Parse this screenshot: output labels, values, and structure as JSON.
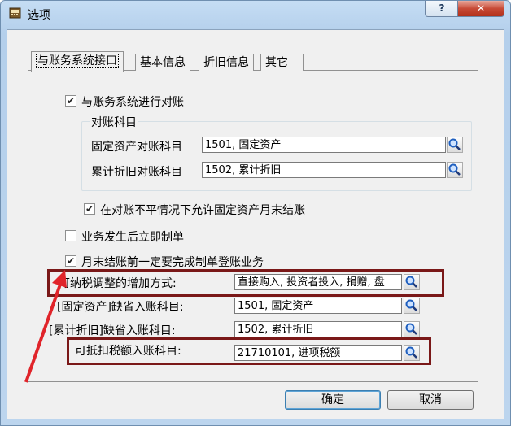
{
  "window": {
    "title": "选项",
    "help_label": "?",
    "close_label": "✕"
  },
  "tabs": [
    {
      "label": "与账务系统接口",
      "active": true
    },
    {
      "label": "基本信息",
      "active": false
    },
    {
      "label": "折旧信息",
      "active": false
    },
    {
      "label": "其它",
      "active": false
    }
  ],
  "options": {
    "reconcile": {
      "label": "与账务系统进行对账",
      "checked": true
    },
    "allow_close": {
      "label": "在对账不平情况下允许固定资产月末结账",
      "checked": true
    },
    "voucher_immediately": {
      "label": "业务发生后立即制单",
      "checked": false
    },
    "month_end": {
      "label": "月末结账前一定要完成制单登账业务",
      "checked": true
    }
  },
  "reconcile_accounts": {
    "group_title": "对账科目",
    "fixed_asset": {
      "label": "固定资产对账科目",
      "value": "1501, 固定资产"
    },
    "depreciation": {
      "label": "累计折旧对账科目",
      "value": "1502, 累计折旧"
    }
  },
  "defaults": {
    "tax_adjust": {
      "label": "可纳税调整的增加方式:",
      "value": "直接购入, 投资者投入, 捐赠, 盘"
    },
    "fixed_asset_default": {
      "label": "[固定资产]缺省入账科目:",
      "value": "1501, 固定资产"
    },
    "depreciation_default": {
      "label": "[累计折旧]缺省入账科目:",
      "value": "1502, 累计折旧"
    },
    "deductible_tax": {
      "label": "可抵扣税额入账科目:",
      "value": "21710101, 进项税额"
    }
  },
  "buttons": {
    "ok": "确定",
    "cancel": "取消"
  },
  "colors": {
    "highlight": "#7a1818",
    "arrow": "#e0242a",
    "search_icon": "#1f5fbf"
  }
}
